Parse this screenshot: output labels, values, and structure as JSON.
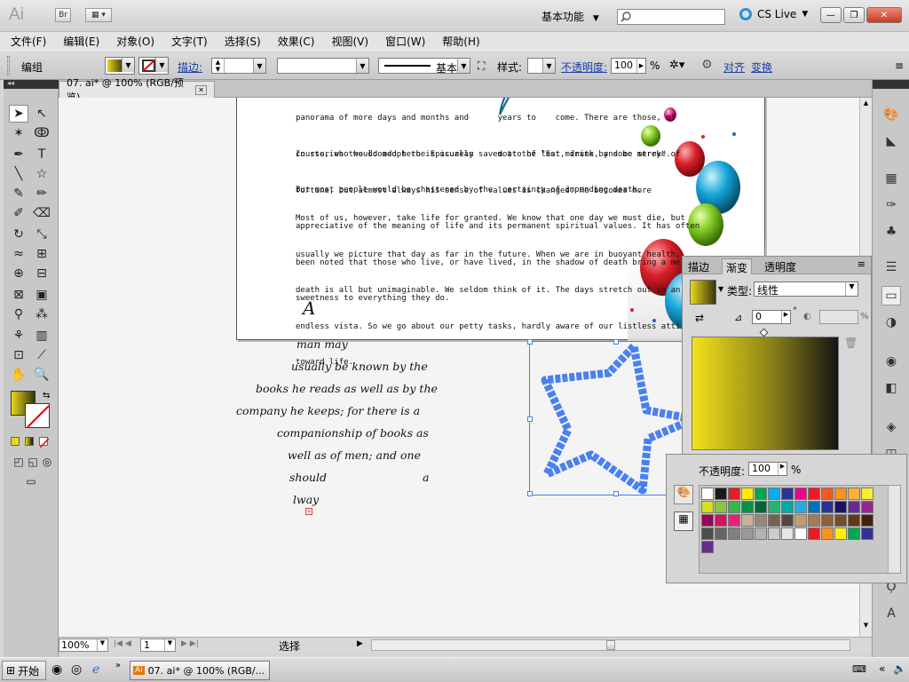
{
  "app": {
    "logo_text": "Ai",
    "bridge_label": "Br",
    "workspace": "基本功能",
    "cslive": "CS Live",
    "window_minimize": "—",
    "window_restore": "❐",
    "window_close": "✕"
  },
  "menu": [
    "文件(F)",
    "编辑(E)",
    "对象(O)",
    "文字(T)",
    "选择(S)",
    "效果(C)",
    "视图(V)",
    "窗口(W)",
    "帮助(H)"
  ],
  "control": {
    "group_label": "编组",
    "stroke_label": "描边:",
    "brush_label": "基本",
    "style_label": "样式:",
    "opacity_label": "不透明度:",
    "opacity_value": "100",
    "opacity_unit": "%",
    "align_link": "对齐",
    "transform_link": "变换"
  },
  "document": {
    "tab_title": "07. ai* @ 100% (RGB/预览)",
    "tab_close": "✕"
  },
  "artboard_text": {
    "p1": [
      "panorama of more days and months and      years to    come. There are those, of",
      "course, who would adopt the Epicurean     motto of \"Eat, drink, and be merry\".",
      "But most people would be chastened by the  certainty of impending death."
    ],
    "p2": [
      "In stories the doomed hero is usually saved at the last minute by some stroke of",
      "fortune, but almost always his sense of values is changed. He becomes more",
      "appreciative of the meaning of life and its permanent spiritual values. It has often",
      "been noted that those who live, or have lived, in the shadow of death bring a mellow",
      "sweetness to everything they do."
    ],
    "p3": [
      "Most of us, however, take life for granted. We know that one day we must die, but",
      "usually we picture that day as far in the future. When we are in buoyant health,",
      "death is all but unimaginable. We seldom think of it. The days stretch out in an",
      "endless vista. So we go about our petty tasks, hardly aware of our listless attitude",
      "toward life."
    ]
  },
  "script_text": [
    "A",
    "man may",
    "usually be known by the",
    "books he reads as well as by the",
    "company he keeps; for there is a",
    "companionship of books as",
    "well as of men; and one",
    "should",
    "a",
    "lway"
  ],
  "gradient_panel": {
    "tabs": [
      "描边",
      "渐变",
      "透明度"
    ],
    "type_label": "类型:",
    "type_value": "线性",
    "angle_value": "0",
    "ratio_unit": "%"
  },
  "swatch_panel": {
    "opacity_label": "不透明度:",
    "opacity_value": "100",
    "opacity_unit": "%",
    "colors": [
      "#ffffff",
      "#1a1a1a",
      "#e31e24",
      "#ffed00",
      "#00a651",
      "#00aeef",
      "#2e3192",
      "#ec008c",
      "#ed1c24",
      "#f15a24",
      "#f7931e",
      "#fbb03b",
      "#f9ed32",
      "#d7df23",
      "#8cc63f",
      "#39b54a",
      "#009245",
      "#006837",
      "#22b573",
      "#00a99d",
      "#29abe2",
      "#0071bc",
      "#2e3192",
      "#1b1464",
      "#662d91",
      "#93278f",
      "#9e005d",
      "#d4145a",
      "#ed1e79",
      "#c7b299",
      "#998675",
      "#736357",
      "#534741",
      "#c69c6d",
      "#a67c52",
      "#8c6239",
      "#754c24",
      "#603813",
      "#42210b",
      "#4d4d4d",
      "#666666",
      "#808080",
      "#999999",
      "#b3b3b3",
      "#cccccc",
      "#e6e6e6",
      "#ffffff",
      "#ed1c24",
      "#f7931e",
      "#fff200",
      "#00a651",
      "#2e3192",
      "#662d91"
    ]
  },
  "status": {
    "zoom": "100%",
    "page": "1",
    "mode": "选择"
  },
  "taskbar": {
    "start": "开始",
    "task": "07. ai* @ 100% (RGB/..."
  }
}
